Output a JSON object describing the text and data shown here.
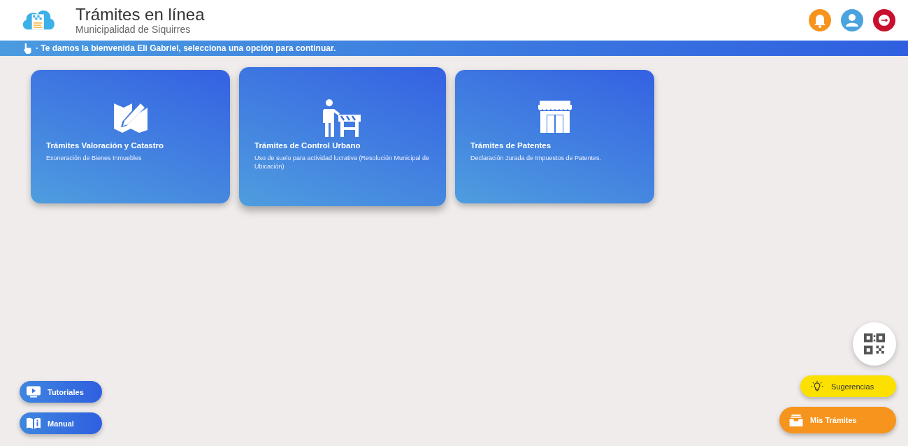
{
  "header": {
    "title": "Trámites en línea",
    "subtitle": "Municipalidad de Siquirres",
    "actions": [
      {
        "kind": "bell"
      },
      {
        "kind": "user"
      },
      {
        "kind": "logout"
      }
    ]
  },
  "banner": {
    "text": "· Te damos la bienvenida Eli Gabriel, selecciona una opción para continuar."
  },
  "cards": [
    {
      "kind": "map",
      "title": "Trámites Valoración y Catastro",
      "description": "Exoneración de Bienes Inmuebles",
      "hovered": false
    },
    {
      "kind": "barrier",
      "title": "Trámites de Control Urbano",
      "description": "Uso de suelo para actividad lucrativa (Resolución Municipal de Ubicación)",
      "hovered": true
    },
    {
      "kind": "store",
      "title": "Trámites de Patentes",
      "description": "Declaración Jurada de Impuestos de Patentes.",
      "hovered": false
    }
  ],
  "help_buttons": [
    {
      "kind": "video",
      "label": "Tutoriales"
    },
    {
      "kind": "book",
      "label": "Manual"
    }
  ],
  "floating": {
    "qr": {
      "kind": "qr"
    },
    "buttons": [
      {
        "kind": "suggest",
        "label": "Sugerencias"
      },
      {
        "kind": "inbox",
        "label": "Mis Trámites"
      }
    ]
  }
}
